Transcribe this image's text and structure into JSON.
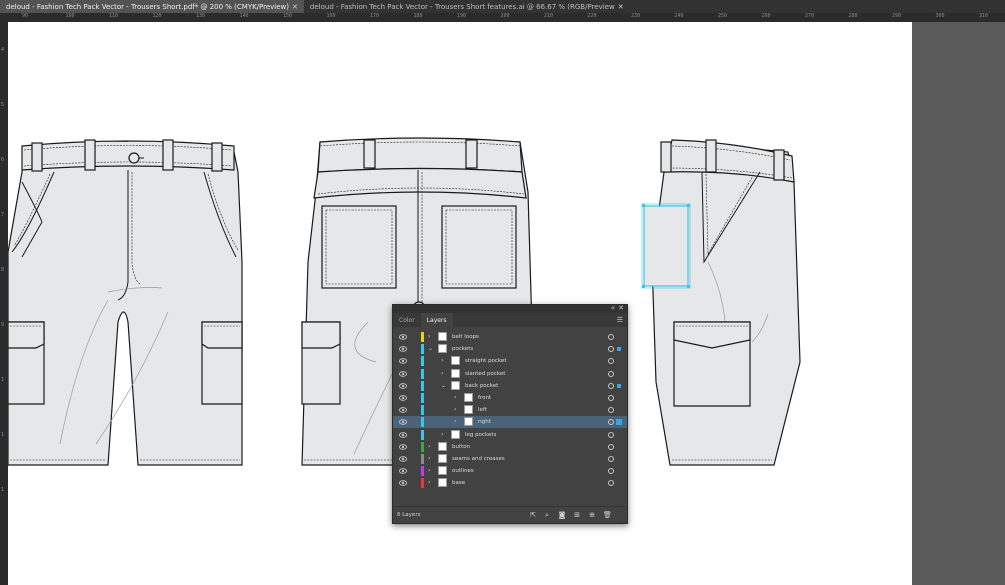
{
  "tabs": [
    {
      "label": "deloud - Fashion Tech Pack Vector - Trousers Short.pdf* @ 200 % (CMYK/Preview)",
      "active": true
    },
    {
      "label": "deloud - Fashion Tech Pack Vector - Trousers Short features.ai @ 66.67 % (RGB/Preview",
      "active": false
    }
  ],
  "ruler_top_labels": [
    "90",
    "100",
    "110",
    "120",
    "130",
    "140",
    "150",
    "160",
    "170",
    "180",
    "190",
    "200",
    "210",
    "220",
    "230",
    "240",
    "250",
    "260",
    "270",
    "280",
    "290",
    "300",
    "310"
  ],
  "ruler_left_labels": [
    "4",
    "5",
    "6",
    "7",
    "8",
    "9",
    "1",
    "1",
    "1"
  ],
  "panel": {
    "tabs": [
      {
        "label": "Color",
        "active": false
      },
      {
        "label": "Layers",
        "active": true
      }
    ],
    "layers_count": "6 Layers",
    "layers": [
      {
        "name": "belt loops",
        "indent": 0,
        "expanded": false,
        "color": "#e6d21e",
        "selected": false
      },
      {
        "name": "pockets",
        "indent": 0,
        "expanded": true,
        "color": "#3ac6e6",
        "selected": false
      },
      {
        "name": "straight pocket",
        "indent": 1,
        "expanded": false,
        "color": "#3ac6e6",
        "selected": false
      },
      {
        "name": "slanted pocket",
        "indent": 1,
        "expanded": false,
        "color": "#3ac6e6",
        "selected": false
      },
      {
        "name": "back pocket",
        "indent": 1,
        "expanded": true,
        "color": "#3ac6e6",
        "selected": false
      },
      {
        "name": "front",
        "indent": 2,
        "expanded": false,
        "color": "#3ac6e6",
        "selected": false
      },
      {
        "name": "left",
        "indent": 2,
        "expanded": false,
        "color": "#3ac6e6",
        "selected": false
      },
      {
        "name": "right",
        "indent": 2,
        "expanded": false,
        "color": "#3ac6e6",
        "selected": true
      },
      {
        "name": "leg pockets",
        "indent": 1,
        "expanded": false,
        "color": "#3ac6e6",
        "selected": false
      },
      {
        "name": "button",
        "indent": 0,
        "expanded": false,
        "color": "#3aa84a",
        "selected": false
      },
      {
        "name": "seams and creases",
        "indent": 0,
        "expanded": false,
        "color": "#8a8a8a",
        "selected": false
      },
      {
        "name": "outlines",
        "indent": 0,
        "expanded": false,
        "color": "#c43ae6",
        "selected": false
      },
      {
        "name": "base",
        "indent": 0,
        "expanded": false,
        "color": "#e63a3a",
        "selected": false
      }
    ]
  },
  "colors": {
    "selection": "#3ac6e6",
    "garment_fill": "#e6e7e8",
    "outline": "#1a1a1a"
  }
}
